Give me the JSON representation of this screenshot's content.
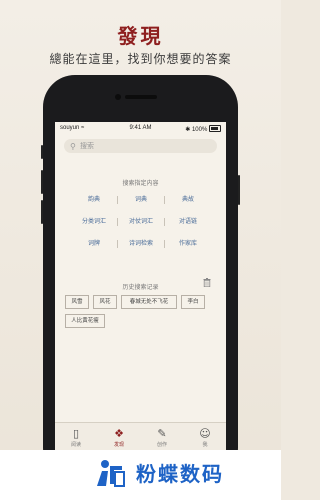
{
  "promo": {
    "headline": "發現",
    "subhead": "總能在這里，找到你想要的答案"
  },
  "status_bar": {
    "carrier": "souyun",
    "time": "9:41 AM",
    "battery": "100%"
  },
  "search": {
    "placeholder": "搜索",
    "icon": "search-icon"
  },
  "search_in": {
    "title": "搜索指定内容",
    "rows": [
      [
        "韵典",
        "词典",
        "典故"
      ],
      [
        "分类词汇",
        "对仗词汇",
        "对语链"
      ],
      [
        "词牌",
        "诗词检索",
        "作家库"
      ]
    ]
  },
  "history": {
    "title": "历史搜索记录",
    "tags": [
      "风雪",
      "风花",
      "春城无处不飞花",
      "李白",
      "人比黄花瘦"
    ]
  },
  "tabbar": {
    "tabs": [
      {
        "label": "阅读",
        "icon": "book-icon"
      },
      {
        "label": "发现",
        "icon": "discover-icon",
        "active": true
      },
      {
        "label": "创作",
        "icon": "brush-icon"
      },
      {
        "label": "我",
        "icon": "user-icon"
      }
    ]
  },
  "footer": {
    "logo_text": "粉蝶数码"
  },
  "colors": {
    "accent": "#8e1f1f",
    "link": "#4a6c99",
    "brand": "#1e63c6"
  }
}
